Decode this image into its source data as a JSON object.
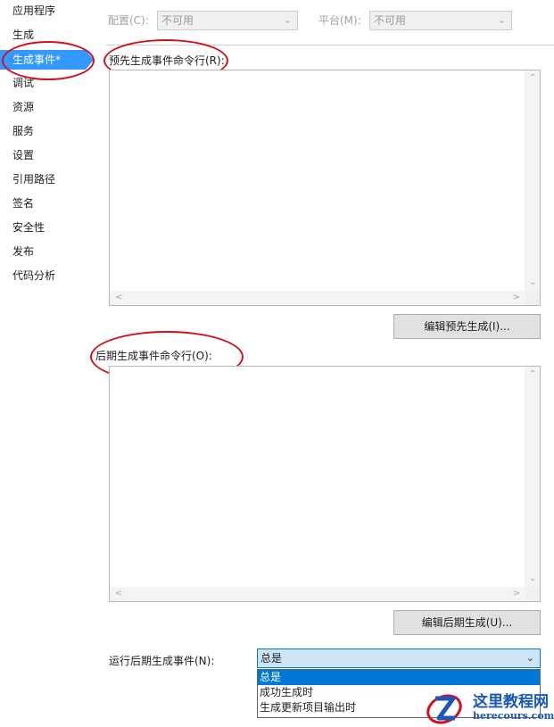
{
  "sidebar": {
    "items": [
      {
        "label": "应用程序"
      },
      {
        "label": "生成"
      },
      {
        "label": "生成事件*"
      },
      {
        "label": "调试"
      },
      {
        "label": "资源"
      },
      {
        "label": "服务"
      },
      {
        "label": "设置"
      },
      {
        "label": "引用路径"
      },
      {
        "label": "签名"
      },
      {
        "label": "安全性"
      },
      {
        "label": "发布"
      },
      {
        "label": "代码分析"
      }
    ],
    "selected_index": 2
  },
  "config_bar": {
    "config_label": "配置(C):",
    "config_value": "不可用",
    "platform_label": "平台(M):",
    "platform_value": "不可用"
  },
  "pre_build": {
    "label": "预先生成事件命令行(R):",
    "command_text": "",
    "edit_button": "编辑预先生成(I)..."
  },
  "post_build": {
    "label": "后期生成事件命令行(O):",
    "command_text": "",
    "edit_button": "编辑后期生成(U)..."
  },
  "run_post_build": {
    "label": "运行后期生成事件(N):",
    "selected": "总是",
    "options": [
      "总是",
      "成功生成时",
      "生成更新项目输出时"
    ]
  },
  "watermark": {
    "title": "这里教程网",
    "domain": "herecours.com"
  },
  "colors": {
    "accent": "#3399ff",
    "annotation": "#d0101a",
    "dropdown_highlight": "#0078d7"
  }
}
